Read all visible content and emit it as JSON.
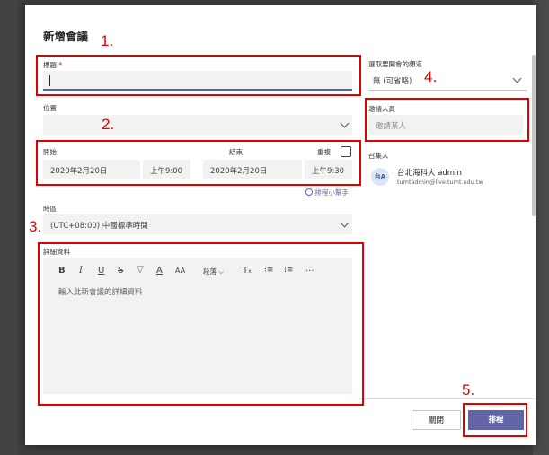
{
  "dialog": {
    "title": "新增會議",
    "title_field": {
      "label": "標題",
      "required_mark": "*",
      "value": ""
    },
    "location": {
      "label": "位置",
      "value": ""
    },
    "start": {
      "label": "開始",
      "date": "2020年2月20日",
      "time": "上午9:00"
    },
    "end": {
      "label": "結束",
      "date": "2020年2月20日",
      "time": "上午9:30"
    },
    "repeat_label": "重複",
    "scheduling_assistant": "排程小幫手",
    "timezone": {
      "label": "時區",
      "value": "(UTC+08:00) 中國標準時間"
    },
    "details": {
      "label": "詳細資料",
      "placeholder": "輸入此新會議的詳細資料",
      "toolbar": [
        "B",
        "I",
        "U",
        "S",
        "A",
        "A",
        "AA",
        "段落",
        "T",
        "列表",
        "編號",
        "..."
      ]
    },
    "channel": {
      "label": "選取要開會的頻道",
      "value": "無 (可省略)"
    },
    "attendees": {
      "label": "邀請人員",
      "placeholder": "邀請某人"
    },
    "organizer": {
      "label": "召集人",
      "avatar": "台A",
      "name": "台北海科大 admin",
      "email": "tumtadmin@live.tumt.edu.tw"
    },
    "close_label": "關閉",
    "schedule_label": "排程"
  },
  "annotations": [
    "1.",
    "2.",
    "3.",
    "4.",
    "5."
  ],
  "colors": {
    "accent": "#6264a7",
    "annotation": "#e00000"
  }
}
